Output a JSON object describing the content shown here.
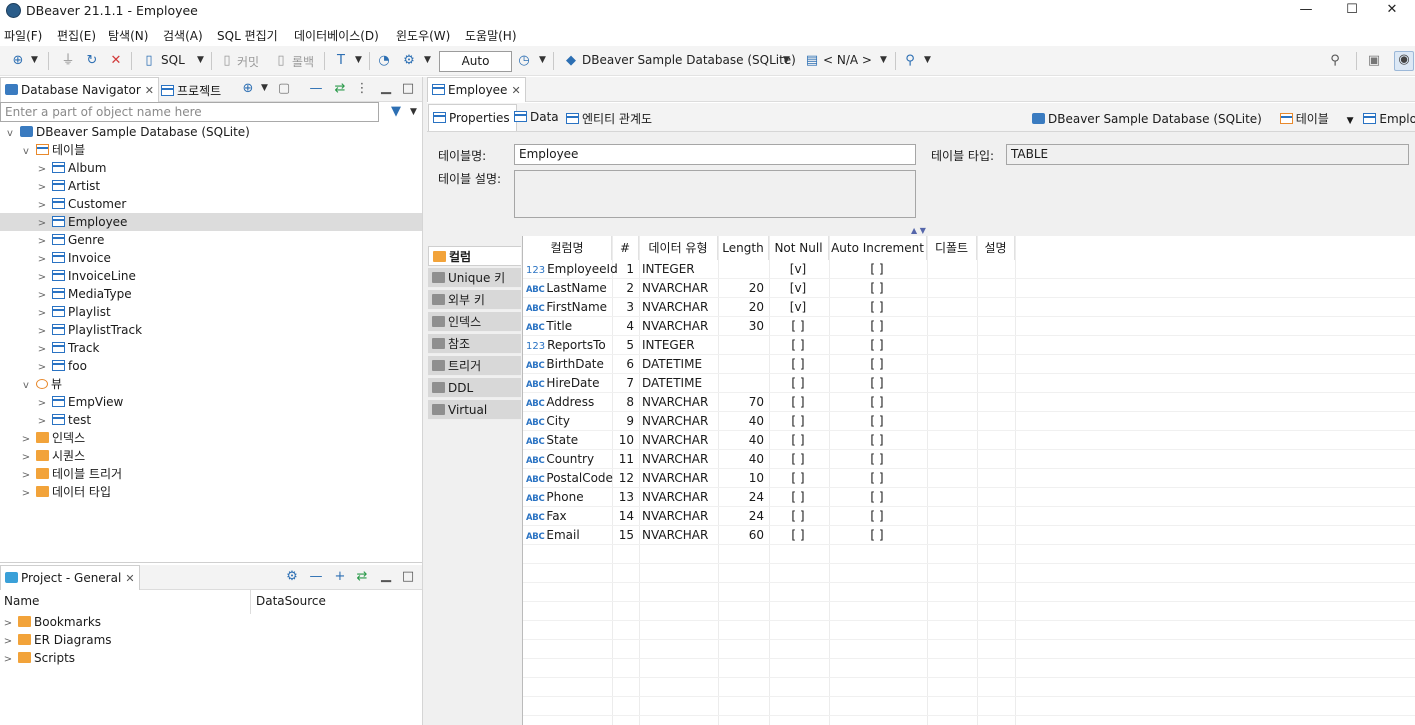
{
  "window": {
    "title": "DBeaver 21.1.1 - Employee",
    "controls": [
      "—",
      "☐",
      "✕"
    ]
  },
  "menu": [
    "파일(F)",
    "편집(E)",
    "탐색(N)",
    "검색(A)",
    "SQL 편집기",
    "데이터베이스(D)",
    "윈도우(W)",
    "도움말(H)"
  ],
  "toolbar": {
    "sql_label": "SQL",
    "commit_label": "커밋",
    "rollback_label": "롤백",
    "transaction_mode": "Auto",
    "datasource": "DBeaver Sample Database (SQLite)",
    "schema": "< N/A >"
  },
  "navigator": {
    "tab_label": "Database Navigator",
    "project_tab_label": "프로젝트",
    "filter_placeholder": "Enter a part of object name here",
    "root": "DBeaver Sample Database (SQLite)",
    "tables_folder": "테이블",
    "tables": [
      "Album",
      "Artist",
      "Customer",
      "Employee",
      "Genre",
      "Invoice",
      "InvoiceLine",
      "MediaType",
      "Playlist",
      "PlaylistTrack",
      "Track",
      "foo"
    ],
    "selected_table": "Employee",
    "views_folder": "뷰",
    "views": [
      "EmpView",
      "test"
    ],
    "other_folders": [
      "인덱스",
      "시퀀스",
      "테이블 트리거",
      "데이터 타입"
    ]
  },
  "project": {
    "tab_label": "Project - General",
    "columns": [
      "Name",
      "DataSource"
    ],
    "items": [
      "Bookmarks",
      "ER Diagrams",
      "Scripts"
    ]
  },
  "editor": {
    "tab_label": "Employee",
    "subtabs": [
      "Properties",
      "Data",
      "엔티티 관계도"
    ],
    "breadcrumb": {
      "datasource": "DBeaver Sample Database (SQLite)",
      "folder": "테이블",
      "object": "Employee"
    },
    "table_name_label": "테이블명:",
    "table_name_value": "Employee",
    "table_type_label": "테이블 타입:",
    "table_type_value": "TABLE",
    "table_desc_label": "테이블 설명:",
    "side_tabs": [
      "컬럼",
      "Unique 키",
      "외부 키",
      "인덱스",
      "참조",
      "트리거",
      "DDL",
      "Virtual"
    ],
    "grid_headers": [
      "컬럼명",
      "#",
      "데이터 유형",
      "Length",
      "Not Null",
      "Auto Increment",
      "디폴트",
      "설명"
    ],
    "columns": [
      {
        "name": "EmployeeId",
        "kind": "123",
        "pos": "1",
        "type": "INTEGER",
        "length": "",
        "not_null": "[v]",
        "auto_inc": "[ ]"
      },
      {
        "name": "LastName",
        "kind": "ABC",
        "pos": "2",
        "type": "NVARCHAR",
        "length": "20",
        "not_null": "[v]",
        "auto_inc": "[ ]"
      },
      {
        "name": "FirstName",
        "kind": "ABC",
        "pos": "3",
        "type": "NVARCHAR",
        "length": "20",
        "not_null": "[v]",
        "auto_inc": "[ ]"
      },
      {
        "name": "Title",
        "kind": "ABC",
        "pos": "4",
        "type": "NVARCHAR",
        "length": "30",
        "not_null": "[ ]",
        "auto_inc": "[ ]"
      },
      {
        "name": "ReportsTo",
        "kind": "123",
        "pos": "5",
        "type": "INTEGER",
        "length": "",
        "not_null": "[ ]",
        "auto_inc": "[ ]"
      },
      {
        "name": "BirthDate",
        "kind": "ABC",
        "pos": "6",
        "type": "DATETIME",
        "length": "",
        "not_null": "[ ]",
        "auto_inc": "[ ]"
      },
      {
        "name": "HireDate",
        "kind": "ABC",
        "pos": "7",
        "type": "DATETIME",
        "length": "",
        "not_null": "[ ]",
        "auto_inc": "[ ]"
      },
      {
        "name": "Address",
        "kind": "ABC",
        "pos": "8",
        "type": "NVARCHAR",
        "length": "70",
        "not_null": "[ ]",
        "auto_inc": "[ ]"
      },
      {
        "name": "City",
        "kind": "ABC",
        "pos": "9",
        "type": "NVARCHAR",
        "length": "40",
        "not_null": "[ ]",
        "auto_inc": "[ ]"
      },
      {
        "name": "State",
        "kind": "ABC",
        "pos": "10",
        "type": "NVARCHAR",
        "length": "40",
        "not_null": "[ ]",
        "auto_inc": "[ ]"
      },
      {
        "name": "Country",
        "kind": "ABC",
        "pos": "11",
        "type": "NVARCHAR",
        "length": "40",
        "not_null": "[ ]",
        "auto_inc": "[ ]"
      },
      {
        "name": "PostalCode",
        "kind": "ABC",
        "pos": "12",
        "type": "NVARCHAR",
        "length": "10",
        "not_null": "[ ]",
        "auto_inc": "[ ]"
      },
      {
        "name": "Phone",
        "kind": "ABC",
        "pos": "13",
        "type": "NVARCHAR",
        "length": "24",
        "not_null": "[ ]",
        "auto_inc": "[ ]"
      },
      {
        "name": "Fax",
        "kind": "ABC",
        "pos": "14",
        "type": "NVARCHAR",
        "length": "24",
        "not_null": "[ ]",
        "auto_inc": "[ ]"
      },
      {
        "name": "Email",
        "kind": "ABC",
        "pos": "15",
        "type": "NVARCHAR",
        "length": "60",
        "not_null": "[ ]",
        "auto_inc": "[ ]"
      }
    ]
  },
  "colors": {
    "accent": "#2a73c3",
    "folder": "#f2a33a",
    "selected_row": "#dcdcdc"
  }
}
